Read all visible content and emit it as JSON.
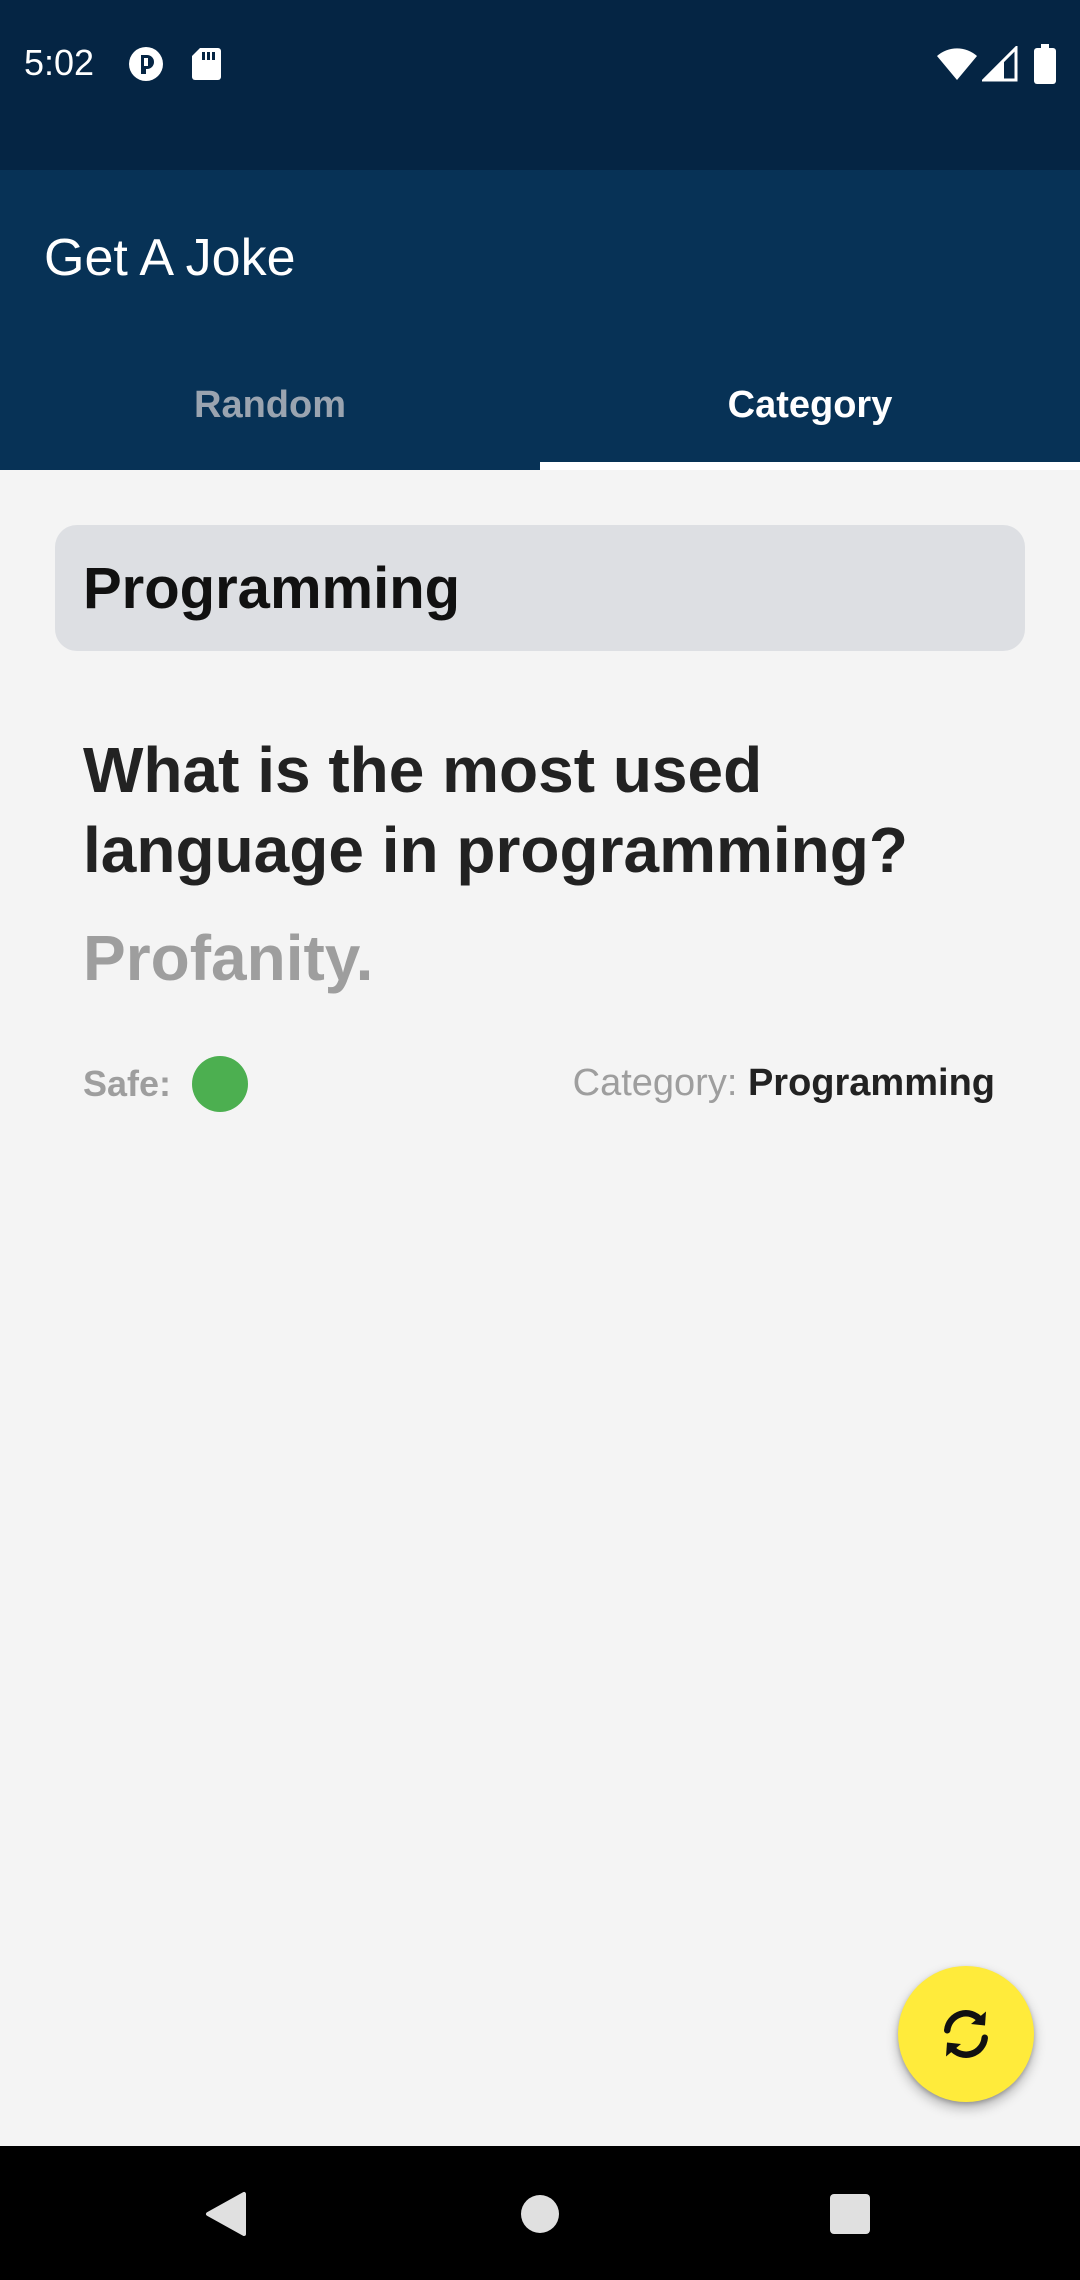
{
  "status_bar": {
    "time": "5:02",
    "icons": [
      "notification-app-icon",
      "sd-card-icon",
      "wifi-icon",
      "signal-icon",
      "battery-icon"
    ]
  },
  "app_bar": {
    "title": "Get A Joke",
    "tabs": [
      {
        "label": "Random",
        "selected": false
      },
      {
        "label": "Category",
        "selected": true
      }
    ]
  },
  "main": {
    "category_select": "Programming",
    "joke": {
      "setup": "What is the most used language in programming?",
      "delivery": "Profanity."
    },
    "safe_label": "Safe:",
    "safe": true,
    "category_label": "Category:",
    "category_value": "Programming"
  },
  "fab": {
    "icon": "refresh-icon"
  },
  "nav_bar": {
    "icons": [
      "back-icon",
      "home-icon",
      "recents-icon"
    ]
  },
  "colors": {
    "status_bar": "#052544",
    "app_bar": "#073256",
    "fab": "#ffeb3b",
    "safe_indicator": "#4caf50",
    "background": "#f4f4f4"
  }
}
